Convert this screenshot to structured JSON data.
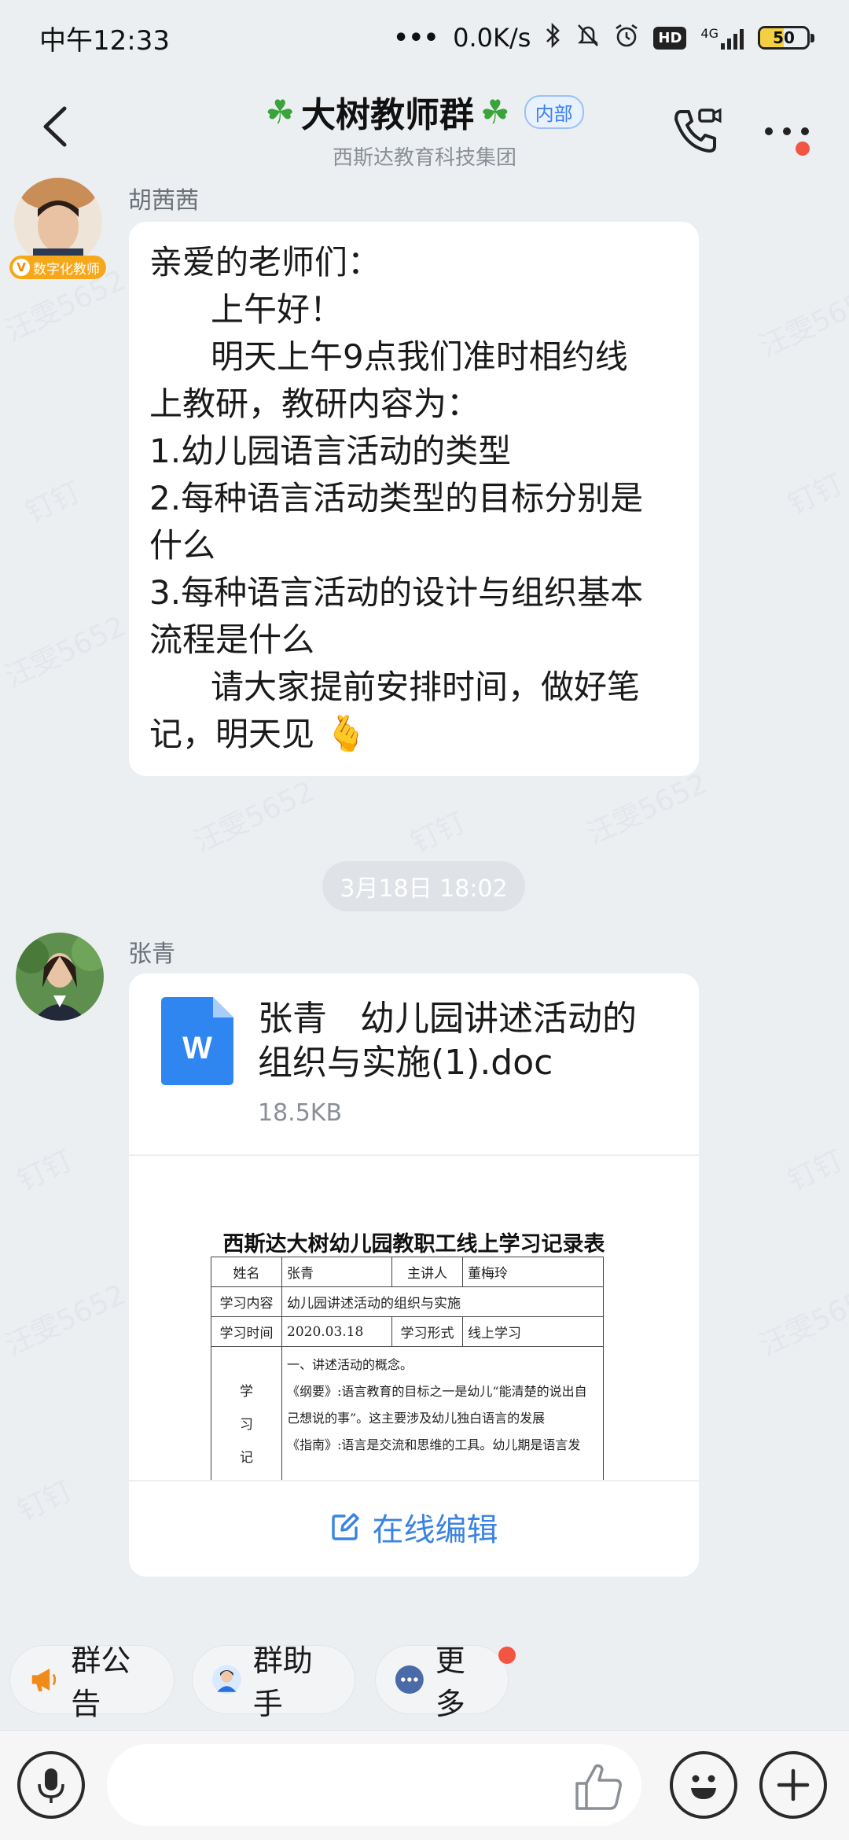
{
  "status_bar": {
    "time": "中午12:33",
    "net_speed": "0.0K/s",
    "network_type": "4G",
    "hd_badge": "HD",
    "battery": "50"
  },
  "header": {
    "title": "大树教师群",
    "title_decoration": "☘",
    "badge": "内部",
    "subtitle": "西斯达教育科技集团"
  },
  "messages": [
    {
      "sender": "胡茜茜",
      "avatar_badge": "数字化教师",
      "avatar_badge_prefix": "V",
      "lines": [
        "亲爱的老师们：",
        "上午好！",
        "明天上午9点我们准时相约线",
        "上教研，教研内容为：",
        "1.幼儿园语言活动的类型",
        "2.每种语言活动类型的目标分别是",
        "什么",
        "3.每种语言活动的设计与组织基本",
        "流程是什么",
        "请大家提前安排时间，做好笔",
        "记，明天见"
      ],
      "emoji": "🫰"
    },
    {
      "timestamp": "3月18日 18:02"
    },
    {
      "sender": "张青",
      "file": {
        "name_line1": "张青   幼儿园讲述活动的",
        "name_line2": "组织与实施(1).doc",
        "size": "18.5KB",
        "icon_letter": "W"
      },
      "preview": {
        "title": "西斯达大树幼儿园教职工线上学习记录表",
        "rows": [
          [
            "姓名",
            "张青",
            "主讲人",
            "董梅玲"
          ],
          [
            "学习内容",
            "幼儿园讲述活动的组织与实施"
          ],
          [
            "学习时间",
            "2020.03.18",
            "学习形式",
            "线上学习"
          ]
        ],
        "side_label": [
          "学",
          "习",
          "记"
        ],
        "body": [
          "一、讲述活动的概念。",
          "《纲要》:语言教育的目标之一是幼儿“能清楚的说出自",
          "己想说的事”。这主要涉及幼儿独白语言的发展",
          "《指南》:语言是交流和思维的工具。幼儿期是语言发"
        ]
      },
      "action": "在线编辑"
    }
  ],
  "quick_actions": [
    {
      "label": "群公告",
      "icon": "megaphone-icon"
    },
    {
      "label": "群助手",
      "icon": "assistant-avatar-icon"
    },
    {
      "label": "更多",
      "icon": "more-dots-icon"
    }
  ],
  "watermark": {
    "name": "汪雯5652",
    "app": "钉钉"
  },
  "colors": {
    "accent": "#3b83e0",
    "background": "#eceff2",
    "red_dot": "#f25643",
    "clover": "#3aa33a"
  }
}
